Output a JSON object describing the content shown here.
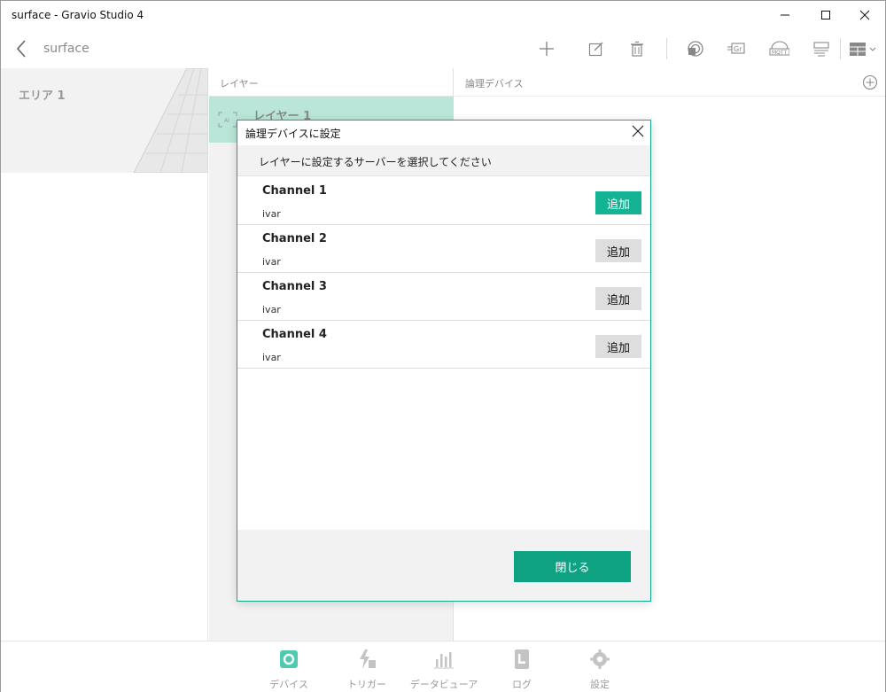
{
  "window": {
    "title": "surface - Gravio Studio 4"
  },
  "appbar": {
    "title": "surface",
    "icons": [
      "add-icon",
      "edit-icon",
      "trash-icon",
      "record-icon",
      "gr-icon",
      "mqtt-icon",
      "list-icon",
      "view-grid-icon"
    ],
    "gr_label": "Gr",
    "mqtt_label": "MQTT"
  },
  "areas": {
    "items": [
      {
        "label": "エリア 1"
      }
    ]
  },
  "layers": {
    "header": "レイヤー",
    "items": [
      {
        "label": "レイヤー 1"
      }
    ]
  },
  "logic": {
    "header": "論理デバイス"
  },
  "dialog": {
    "title": "論理デバイスに設定",
    "subtitle": "レイヤーに設定するサーバーを選択してください",
    "channels": [
      {
        "name": "Channel 1",
        "server": "ivar",
        "button": "追加",
        "active": true
      },
      {
        "name": "Channel 2",
        "server": "ivar",
        "button": "追加",
        "active": false
      },
      {
        "name": "Channel 3",
        "server": "ivar",
        "button": "追加",
        "active": false
      },
      {
        "name": "Channel 4",
        "server": "ivar",
        "button": "追加",
        "active": false
      }
    ],
    "close_label": "閉じる"
  },
  "bottomnav": {
    "items": [
      {
        "label": "デバイス",
        "icon": "device-gear-icon",
        "active": true
      },
      {
        "label": "トリガー",
        "icon": "trigger-icon",
        "active": false
      },
      {
        "label": "データビューア",
        "icon": "bar-chart-icon",
        "active": false
      },
      {
        "label": "ログ",
        "icon": "log-icon",
        "active": false
      },
      {
        "label": "設定",
        "icon": "settings-gear-icon",
        "active": false
      }
    ]
  },
  "colors": {
    "accent": "#0ea283",
    "accent_light": "#13b393",
    "selected_row": "#b9e6d8",
    "panel_bg": "#f2f2f2"
  }
}
